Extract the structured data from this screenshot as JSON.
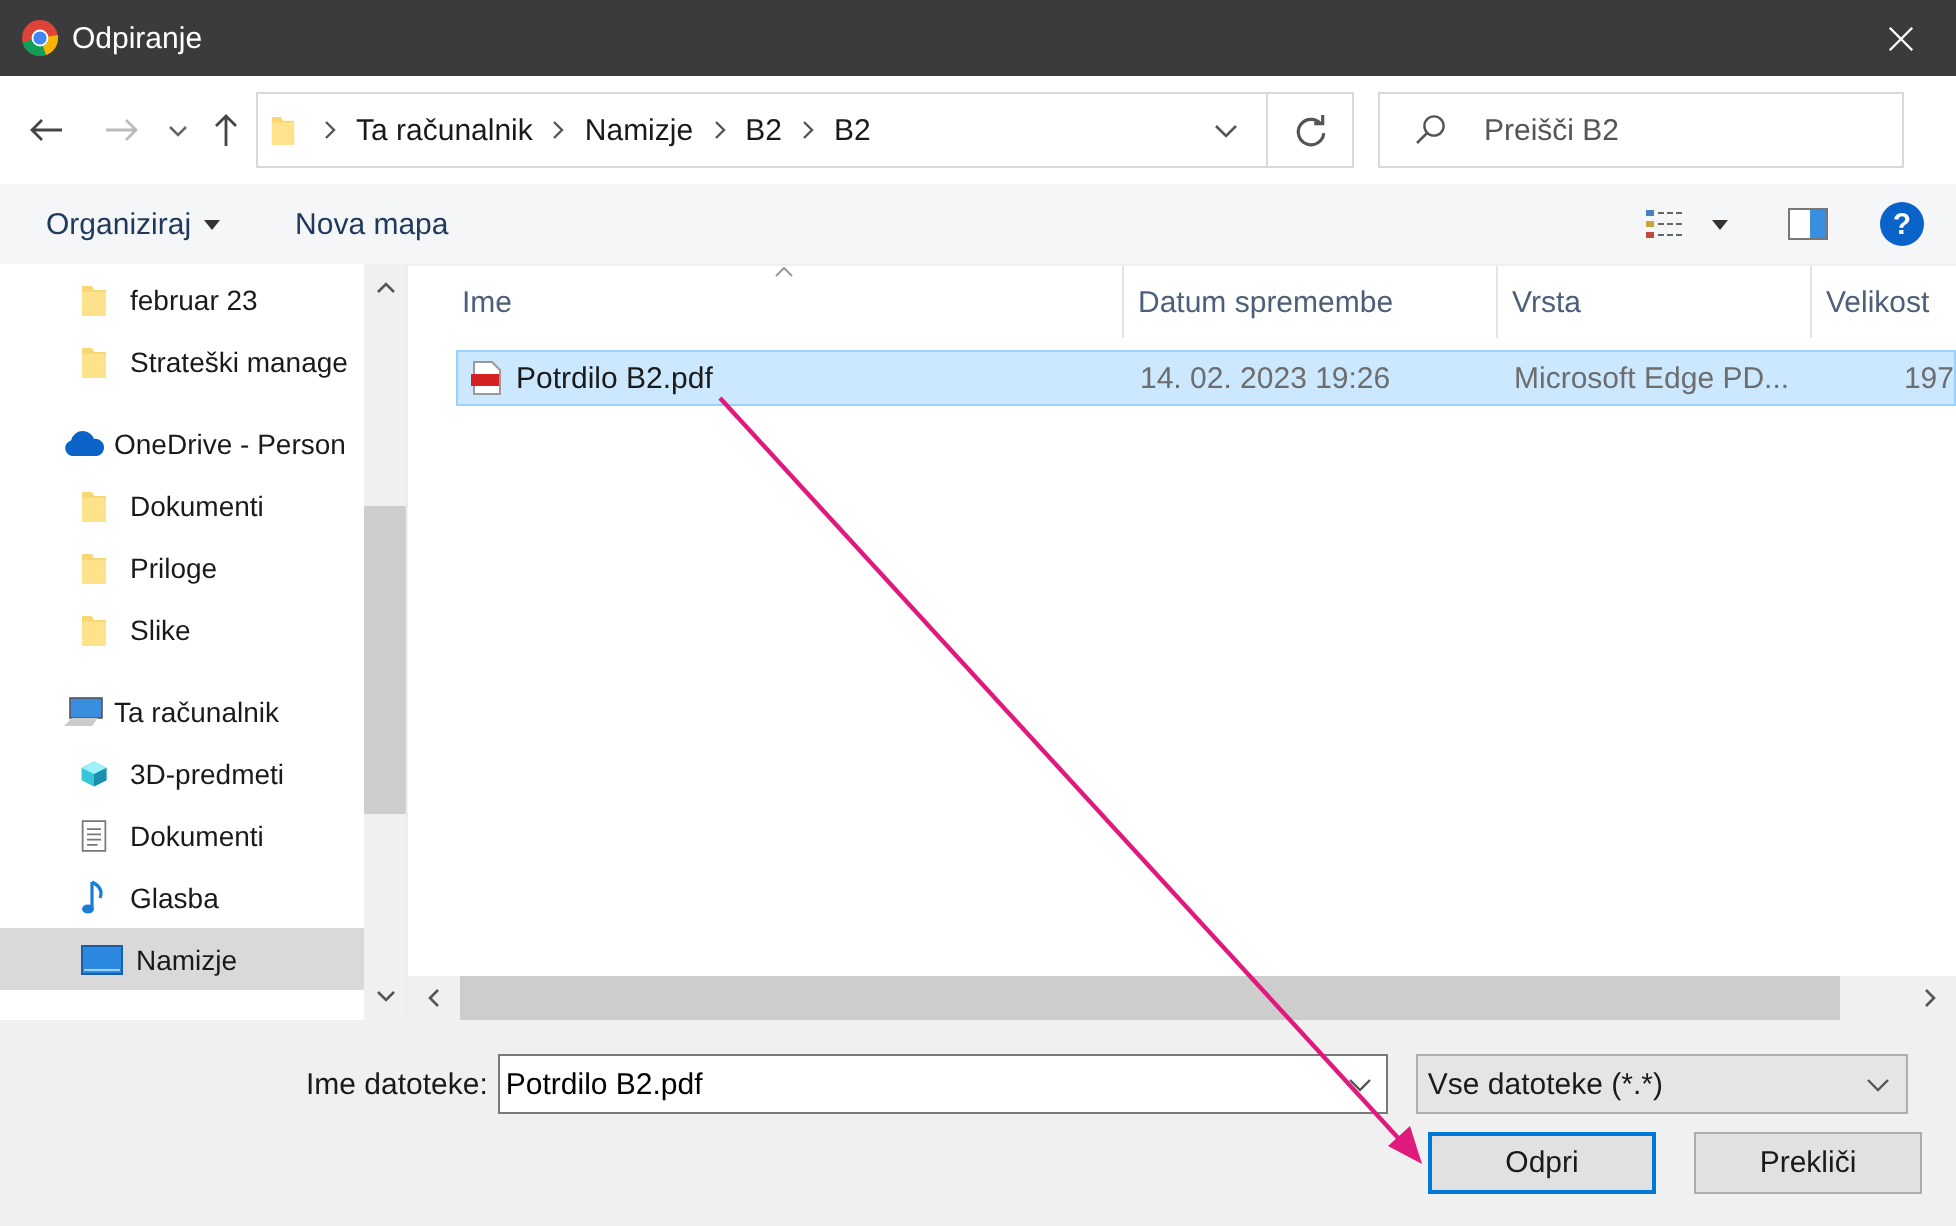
{
  "window": {
    "title": "Odpiranje"
  },
  "breadcrumb": [
    "Ta računalnik",
    "Namizje",
    "B2",
    "B2"
  ],
  "search": {
    "placeholder": "Preišči B2"
  },
  "toolbar": {
    "organize": "Organiziraj",
    "new_folder": "Nova mapa",
    "help": "?"
  },
  "sidebar": {
    "sections": [
      {
        "items": [
          {
            "label": "februar 23",
            "kind": "folder",
            "selected": false
          },
          {
            "label": "Strateški manage",
            "kind": "folder",
            "selected": false
          }
        ]
      },
      {
        "header": {
          "label": "OneDrive - Person",
          "kind": "onedrive",
          "selected": false
        },
        "children": [
          {
            "label": "Dokumenti",
            "kind": "folder",
            "selected": false
          },
          {
            "label": "Priloge",
            "kind": "folder",
            "selected": false
          },
          {
            "label": "Slike",
            "kind": "folder",
            "selected": false
          }
        ]
      },
      {
        "header": {
          "label": "Ta računalnik",
          "kind": "computer",
          "selected": false
        },
        "children": [
          {
            "label": "3D-predmeti",
            "kind": "cube",
            "selected": false
          },
          {
            "label": "Dokumenti",
            "kind": "document",
            "selected": false
          },
          {
            "label": "Glasba",
            "kind": "music",
            "selected": false
          },
          {
            "label": "Namizje",
            "kind": "desktop",
            "selected": true
          }
        ]
      }
    ]
  },
  "table": {
    "columns": [
      "Ime",
      "Datum spremembe",
      "Vrsta",
      "Velikost"
    ],
    "rows": [
      {
        "cells": [
          "Potrdilo B2.pdf",
          "14. 02. 2023 19:26",
          "Microsoft Edge PD...",
          "197"
        ],
        "selected": true
      }
    ]
  },
  "footer": {
    "filename_label": "Ime datoteke:",
    "filename": "Potrdilo B2.pdf",
    "filter": "Vse datoteke (*.*)",
    "buttons": [
      "Odpri",
      "Prekliči"
    ]
  }
}
